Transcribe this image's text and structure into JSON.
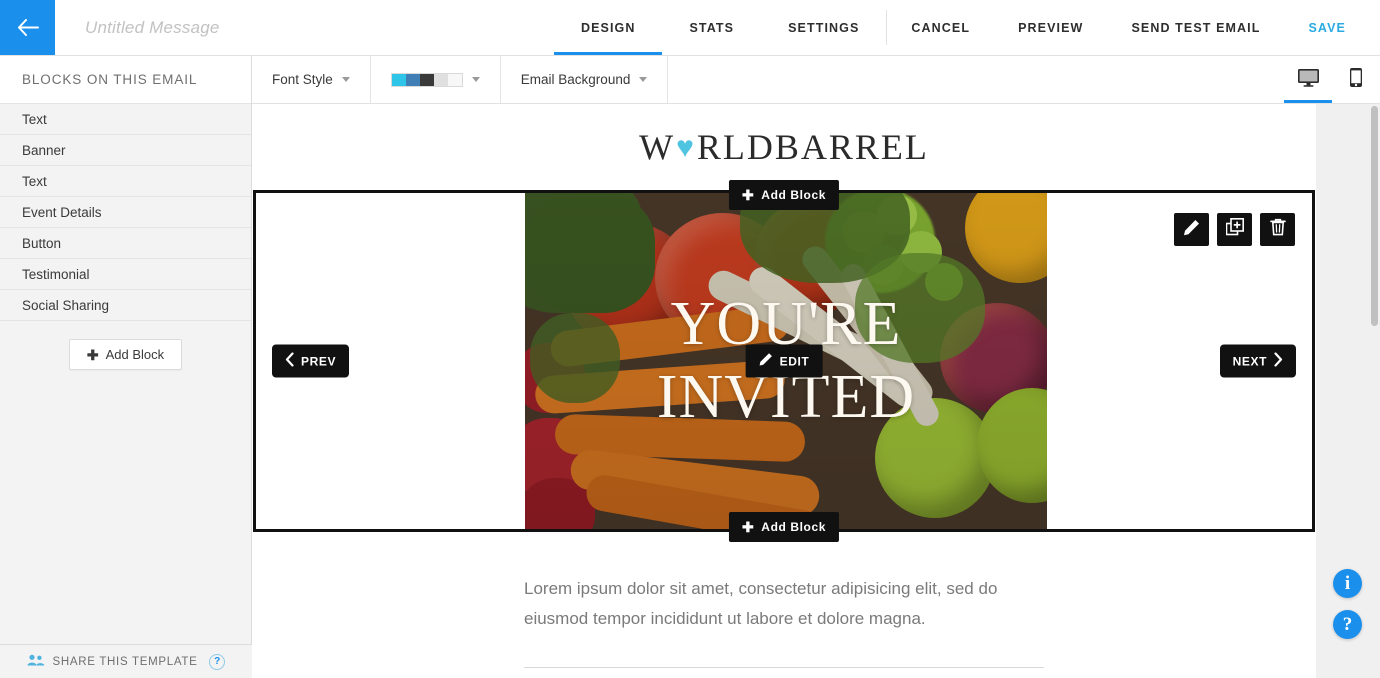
{
  "topbar": {
    "back_icon": "arrow-left-icon",
    "message_title_placeholder": "Untitled Message",
    "message_title_value": "",
    "tabs": [
      {
        "label": "DESIGN",
        "active": true
      },
      {
        "label": "STATS",
        "active": false
      },
      {
        "label": "SETTINGS",
        "active": false
      }
    ],
    "actions": [
      {
        "label": "CANCEL",
        "accent": false
      },
      {
        "label": "PREVIEW",
        "accent": false
      },
      {
        "label": "SEND TEST EMAIL",
        "accent": false
      },
      {
        "label": "SAVE",
        "accent": true
      }
    ]
  },
  "sidebar": {
    "header": "BLOCKS ON THIS EMAIL",
    "items": [
      {
        "label": "Text"
      },
      {
        "label": "Banner"
      },
      {
        "label": "Text"
      },
      {
        "label": "Event Details"
      },
      {
        "label": "Button"
      },
      {
        "label": "Testimonial"
      },
      {
        "label": "Social Sharing"
      }
    ],
    "add_block_label": "Add Block",
    "share_label": "SHARE THIS TEMPLATE",
    "share_help_label": "?"
  },
  "toolbar": {
    "font_style_label": "Font Style",
    "email_background_label": "Email Background",
    "palette_colors": [
      "#2ec5e8",
      "#3f7fb5",
      "#3a3a3a",
      "#e0e0e0",
      "#f7f7f7"
    ],
    "devices": [
      {
        "name": "desktop",
        "active": true
      },
      {
        "name": "mobile",
        "active": false
      }
    ]
  },
  "email": {
    "logo_before": "W",
    "logo_heart": "♥",
    "logo_after": "RLDBARREL",
    "banner": {
      "headline_line1": "YOU'RE",
      "headline_line2": "INVITED",
      "add_block_top_label": "Add Block",
      "add_block_bottom_label": "Add Block",
      "edit_label": "EDIT",
      "prev_label": "PREV",
      "next_label": "NEXT",
      "controls": [
        {
          "name": "edit-block-button",
          "icon": "pencil-icon"
        },
        {
          "name": "duplicate-block-button",
          "icon": "duplicate-icon"
        },
        {
          "name": "delete-block-button",
          "icon": "trash-icon"
        }
      ]
    },
    "body_text": "Lorem ipsum dolor sit amet, consectetur adipisicing elit, sed do eiusmod tempor incididunt ut labore et dolore magna."
  },
  "help": {
    "info_label": "i",
    "question_label": "?"
  },
  "colors": {
    "accent_blue": "#1b8fec",
    "save_blue": "#29abe2",
    "heart_cyan": "#4fc4e0",
    "dark_chrome": "#111111"
  }
}
